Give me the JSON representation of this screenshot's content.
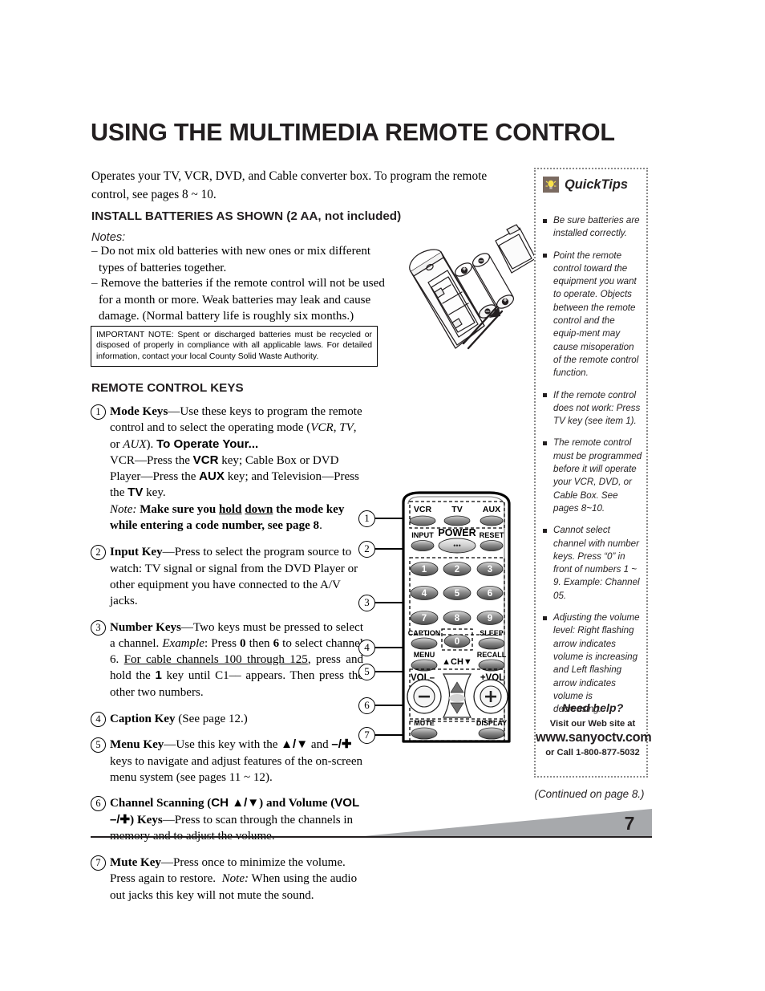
{
  "page": {
    "title": "USING THE MULTIMEDIA REMOTE CONTROL",
    "intro": "Operates your TV, VCR, DVD, and Cable converter box. To program the remote control, see pages 8 ~ 10.",
    "continued": "(Continued on page 8.)",
    "page_number": "7"
  },
  "install": {
    "heading": "INSTALL BATTERIES AS SHOWN (2 AA, not included)",
    "notes_label": "Notes:",
    "note1": "Do not mix old batteries with new ones or mix different types of batteries together.",
    "note2": "Remove the batteries if the remote control will not be used for a month or more. Weak batteries may leak and cause damage. (Normal battery life is roughly six months.)",
    "important": "IMPORTANT NOTE: Spent or discharged batteries must be recycled or disposed of properly in compliance with all applicable laws. For detailed information, contact your local County Solid Waste Authority."
  },
  "keys": {
    "heading": "REMOTE CONTROL KEYS",
    "items": [
      {
        "num": "1",
        "title": "Mode Keys"
      },
      {
        "num": "2",
        "title": "Input Key"
      },
      {
        "num": "3",
        "title": "Number Keys"
      },
      {
        "num": "4",
        "title": "Caption Key"
      },
      {
        "num": "5",
        "title": "Menu Key"
      },
      {
        "num": "6",
        "title": "Channel Scanning"
      },
      {
        "num": "7",
        "title": "Mute Key"
      }
    ],
    "item1_text": "Mode Keys—Use these keys to program the remote control and to select the operating mode (VCR, TV, or AUX). To Operate Your... VCR—Press the VCR key; Cable Box or DVD Player—Press the AUX key; and Television—Press the TV key. Note: Make sure you hold down the mode key while entering a code number, see page 8.",
    "item2_text": "Input Key—Press to select the program source to watch: TV signal or signal from the DVD Player or other equipment you have connected to the A/V jacks.",
    "item3_text": "Number Keys—Two keys must be pressed to select a channel. Example: Press 0 then 6 to select channel 6. For cable channels 100 through 125, press and hold the 1 key until C1-- appears. Then press the other two numbers.",
    "item4_text": "Caption Key (See page 12.)",
    "item5_text": "Menu Key—Use this key with the ▲/▼ and –/+ keys to navigate and adjust features of the on-screen menu system (see pages 11 ~ 12).",
    "item6_text": "Channel Scanning (CH ▲/▼) and Volume (VOL –/+) Keys—Press to scan through the channels in memory and to adjust the volume.",
    "item7_text": "Mute Key—Press once to minimize the volume. Press again to restore. Note: When using the audio out jacks this key will not mute the sound."
  },
  "remote": {
    "mode_buttons": [
      "VCR",
      "TV",
      "AUX"
    ],
    "input": "INPUT",
    "power": "POWER",
    "reset": "RESET",
    "numbers": [
      "1",
      "2",
      "3",
      "4",
      "5",
      "6",
      "7",
      "8",
      "9"
    ],
    "zero": "0",
    "caption": "CAPTION",
    "sleep": "SLEEP",
    "menu": "MENU",
    "recall": "RECALL",
    "ch_label": "CH",
    "vol_minus": "VOL",
    "vol_plus": "VOL",
    "mute": "MUTE",
    "display": "DISPLAY",
    "callouts": [
      "1",
      "2",
      "3",
      "4",
      "5",
      "6",
      "7"
    ]
  },
  "quicktips": {
    "title": "QuickTips",
    "icon": "lightbulb-icon",
    "tips": [
      "Be sure batteries are installed correctly.",
      "Point the remote control toward the equipment you want to operate. Objects between the remote control and the equip-ment may cause misoperation of the remote control function.",
      "If the remote control does not work: Press TV key (see item 1).",
      "The remote control must be programmed before it will operate your VCR, DVD, or Cable Box. See pages 8~10.",
      "Cannot select channel with number keys. Press “0” in front of numbers 1 ~ 9. Example: Channel 05.",
      "Adjusting the volume level: Right flashing arrow indicates volume is increasing and Left flashing arrow indicates volume is decreasing."
    ],
    "help_title": "Need help?",
    "help_line1": "Visit our Web site at",
    "help_site": "www.sanyoctv.com",
    "help_line2": "or Call 1-800-877-5032"
  },
  "colors": {
    "text": "#231f20",
    "wedge": "#a7a9ac",
    "icon_bg": "#7a6a60",
    "bulb": "#f9e24a"
  }
}
